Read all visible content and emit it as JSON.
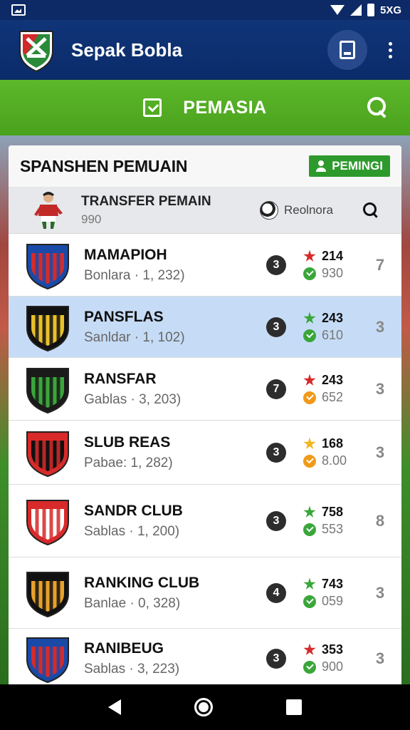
{
  "status_bar": {
    "network": "5XG"
  },
  "app_bar": {
    "title": "Sepak Bobla"
  },
  "tab_bar": {
    "label": "PEMASIA"
  },
  "card": {
    "title": "SPANSHEN PEMUAIN",
    "button_label": "PEMINGI",
    "subheader": {
      "title": "TRANSFER PEMAIN",
      "count": "990",
      "ball_label": "Reolnora"
    }
  },
  "rows": [
    {
      "name": "MAMAPIOH",
      "sub": "Bonlara · 1, 232)",
      "badge": "3",
      "star_color": "red",
      "stat_top": "214",
      "check_color": "green",
      "stat_bottom": "930",
      "num": "7",
      "selected": false
    },
    {
      "name": "PANSFLAS",
      "sub": "Sanldar · 1, 102)",
      "badge": "3",
      "star_color": "green",
      "stat_top": "243",
      "check_color": "green",
      "stat_bottom": "610",
      "num": "3",
      "selected": true
    },
    {
      "name": "RANSFAR",
      "sub": "Gablas · 3, 203)",
      "badge": "7",
      "star_color": "red",
      "stat_top": "243",
      "check_color": "orange",
      "stat_bottom": "652",
      "num": "3",
      "selected": false
    },
    {
      "name": "SLUB REAS",
      "sub": "Pabae: 1, 282)",
      "badge": "3",
      "star_color": "yellow",
      "stat_top": "168",
      "check_color": "orange",
      "stat_bottom": "8.00",
      "num": "3",
      "selected": false
    },
    {
      "name": "SANDR CLUB",
      "sub": "Sablas · 1, 200)",
      "badge": "3",
      "star_color": "green",
      "stat_top": "758",
      "check_color": "green",
      "stat_bottom": "553",
      "num": "8",
      "selected": false
    },
    {
      "name": "RANKING CLUB",
      "sub": "Banlae · 0, 328)",
      "badge": "4",
      "star_color": "green",
      "stat_top": "743",
      "check_color": "green",
      "stat_bottom": "059",
      "num": "3",
      "selected": false
    },
    {
      "name": "RANIBEUG",
      "sub": "Sablas · 3, 223)",
      "badge": "3",
      "star_color": "red",
      "stat_top": "353",
      "check_color": "green",
      "stat_bottom": "900",
      "num": "3",
      "selected": false
    }
  ]
}
